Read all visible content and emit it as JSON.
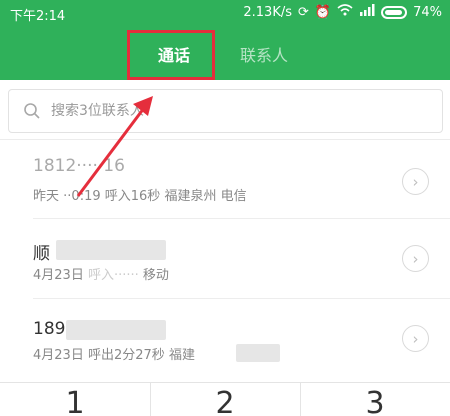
{
  "status_bar": {
    "time": "下午2:14",
    "speed": "2.13K/s",
    "battery": "74%"
  },
  "tabs": [
    {
      "label": "通话",
      "selected": true
    },
    {
      "label": "联系人",
      "selected": false
    }
  ],
  "search": {
    "placeholder": "搜索3位联系人"
  },
  "call_log": [
    {
      "name": "1812·····16",
      "date": "昨天",
      "detail": "··0:19 呼入16秒",
      "location": "福建泉州 电信"
    },
    {
      "name": "顺",
      "date": "4月23日",
      "detail": "呼入······",
      "location": "移动"
    },
    {
      "name": "189",
      "date": "4月23日",
      "detail": "呼出2分27秒",
      "location": "福建"
    }
  ],
  "keypad": {
    "keys": [
      "1",
      "2",
      "3"
    ]
  },
  "colors": {
    "header": "#2fb15a",
    "highlight": "#e52e3c"
  },
  "icons": {
    "search": "search-icon",
    "info": "info-chevron-icon"
  }
}
